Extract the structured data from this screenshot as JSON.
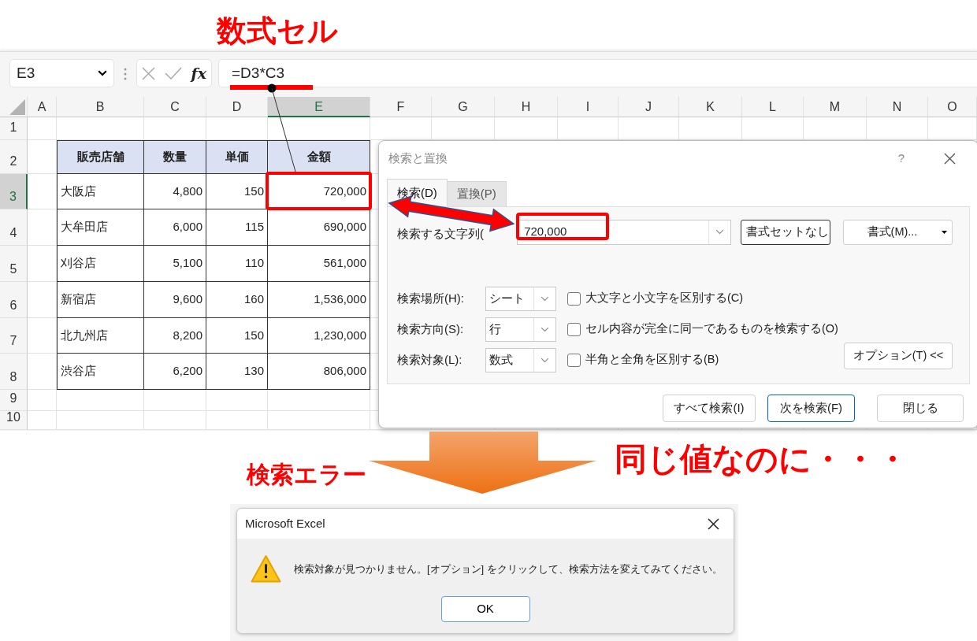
{
  "annotations": {
    "title": "数式セル",
    "error_label": "検索エラー",
    "remark": "同じ値なのに・・・"
  },
  "formula_bar": {
    "name_box": "E3",
    "function_button": "fx",
    "formula": "=D3*C3"
  },
  "sheet": {
    "columns": [
      {
        "label": "A",
        "selected": false
      },
      {
        "label": "B",
        "selected": false
      },
      {
        "label": "C",
        "selected": false
      },
      {
        "label": "D",
        "selected": false
      },
      {
        "label": "E",
        "selected": true
      },
      {
        "label": "F",
        "selected": false
      },
      {
        "label": "G",
        "selected": false
      },
      {
        "label": "H",
        "selected": false
      },
      {
        "label": "I",
        "selected": false
      },
      {
        "label": "J",
        "selected": false
      },
      {
        "label": "K",
        "selected": false
      },
      {
        "label": "L",
        "selected": false
      },
      {
        "label": "M",
        "selected": false
      },
      {
        "label": "N",
        "selected": false
      },
      {
        "label": "O",
        "selected": false
      }
    ],
    "rows": [
      {
        "label": "1",
        "selected": false
      },
      {
        "label": "2",
        "selected": false
      },
      {
        "label": "3",
        "selected": true
      },
      {
        "label": "4",
        "selected": false
      },
      {
        "label": "5",
        "selected": false
      },
      {
        "label": "6",
        "selected": false
      },
      {
        "label": "7",
        "selected": false
      },
      {
        "label": "8",
        "selected": false
      },
      {
        "label": "9",
        "selected": false
      },
      {
        "label": "10",
        "selected": false
      }
    ],
    "table": {
      "header": [
        "販売店舗",
        "数量",
        "単価",
        "金額"
      ],
      "rows": [
        [
          "大阪店",
          "4,800",
          "150",
          "720,000"
        ],
        [
          "大牟田店",
          "6,000",
          "115",
          "690,000"
        ],
        [
          "刈谷店",
          "5,100",
          "110",
          "561,000"
        ],
        [
          "新宿店",
          "9,600",
          "160",
          "1,536,000"
        ],
        [
          "北九州店",
          "8,200",
          "150",
          "1,230,000"
        ],
        [
          "渋谷店",
          "6,200",
          "130",
          "806,000"
        ]
      ]
    }
  },
  "find_dialog": {
    "title": "検索と置換",
    "help": "?",
    "tabs": [
      {
        "label": "検索(D)",
        "selected": true
      },
      {
        "label": "置換(P)",
        "selected": false
      }
    ],
    "find_label": "検索する文字列(",
    "find_value": "720,000",
    "no_format_button": "書式セットなし",
    "format_button": "書式(M)...",
    "selects": [
      {
        "label": "検索場所(H):",
        "value": "シート"
      },
      {
        "label": "検索方向(S):",
        "value": "行"
      },
      {
        "label": "検索対象(L):",
        "value": "数式"
      }
    ],
    "checkboxes": [
      {
        "label": "大文字と小文字を区別する(C)",
        "checked": false
      },
      {
        "label": "セル内容が完全に同一であるものを検索する(O)",
        "checked": false
      },
      {
        "label": "半角と全角を区別する(B)",
        "checked": false
      }
    ],
    "options_button": "オプション(T) <<",
    "buttons": [
      {
        "label": "すべて検索(I)",
        "default": false
      },
      {
        "label": "次を検索(F)",
        "default": true
      },
      {
        "label": "閉じる",
        "default": false
      }
    ]
  },
  "message_box": {
    "title": "Microsoft Excel",
    "message": "検索対象が見つかりません。[オプション] をクリックして、検索方法を変えてみてください。",
    "button": "OK"
  }
}
